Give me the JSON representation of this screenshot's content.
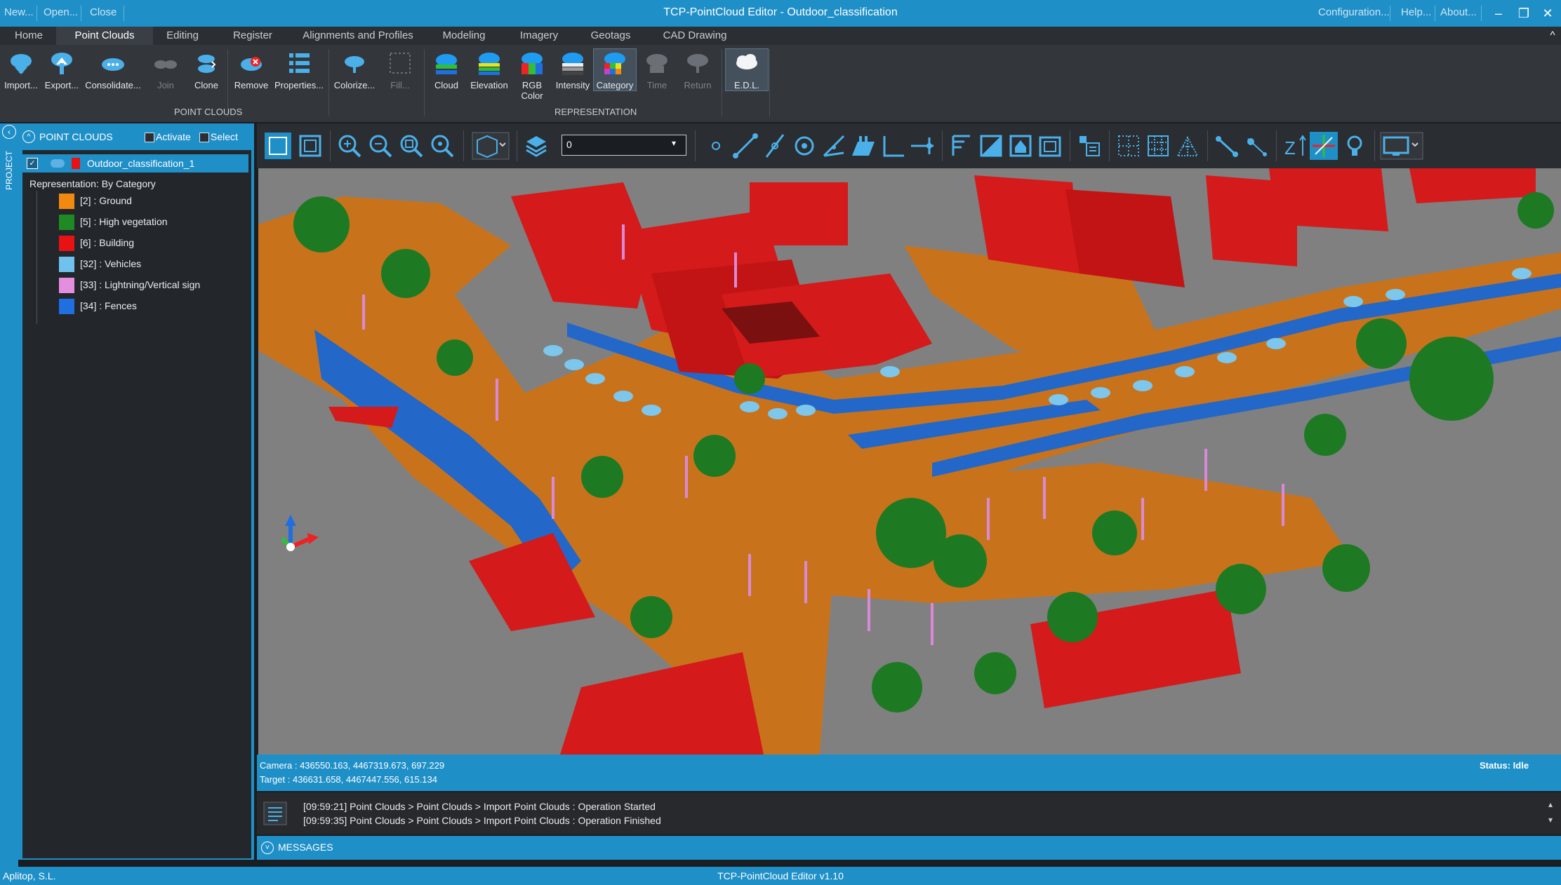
{
  "quick_access": [
    "New...",
    "Open...",
    "Close"
  ],
  "window_title": "TCP-PointCloud Editor - Outdoor_classification",
  "title_links": [
    "Configuration...",
    "Help...",
    "About..."
  ],
  "window_buttons": [
    "minimize-icon",
    "restore-icon",
    "close-icon"
  ],
  "tabs": [
    "Home",
    "Point Clouds",
    "Editing",
    "Register",
    "Alignments and Profiles",
    "Modeling",
    "Imagery",
    "Geotags",
    "CAD Drawing"
  ],
  "active_tab": "Point Clouds",
  "ribbon": {
    "point_clouds": [
      "Import...",
      "Export...",
      "Consolidate...",
      "Join",
      "Clone",
      "Remove",
      "Properties...",
      "Colorize...",
      "Fill..."
    ],
    "point_clouds_group": "POINT CLOUDS",
    "representation": [
      "Cloud",
      "Elevation",
      "RGB Color",
      "Intensity",
      "Category",
      "Time",
      "Return"
    ],
    "representation_group": "REPRESENTATION",
    "edl": "E.D.L."
  },
  "side_tab": "PROJECT",
  "panel": {
    "title": "POINT CLOUDS",
    "activate_label": "Activate",
    "select_label": "Select",
    "cloud_name": "Outdoor_classification_1",
    "representation_label": "Representation: By Category",
    "categories": [
      {
        "label": "[2] : Ground",
        "color": "#f28a0f"
      },
      {
        "label": "[5] : High vegetation",
        "color": "#1f8a24"
      },
      {
        "label": "[6] : Building",
        "color": "#e81212"
      },
      {
        "label": "[32] : Vehicles",
        "color": "#6fc2ee"
      },
      {
        "label": "[33] : Lightning/Vertical sign",
        "color": "#e48ee0"
      },
      {
        "label": "[34] : Fences",
        "color": "#1f6fe0"
      }
    ]
  },
  "viewport": {
    "layer_value": "0"
  },
  "camera_line": "Camera : 436550.163, 4467319.673, 697.229",
  "target_line": "Target : 436631.658, 4467447.556, 615.134",
  "status": "Status: Idle",
  "messages": [
    "[09:59:21] Point Clouds > Point Clouds > Import Point Clouds : Operation Started",
    "[09:59:35] Point Clouds > Point Clouds > Import Point Clouds : Operation Finished"
  ],
  "messages_label": "MESSAGES",
  "company": "Aplitop, S.L.",
  "version": "TCP-PointCloud Editor v1.10"
}
